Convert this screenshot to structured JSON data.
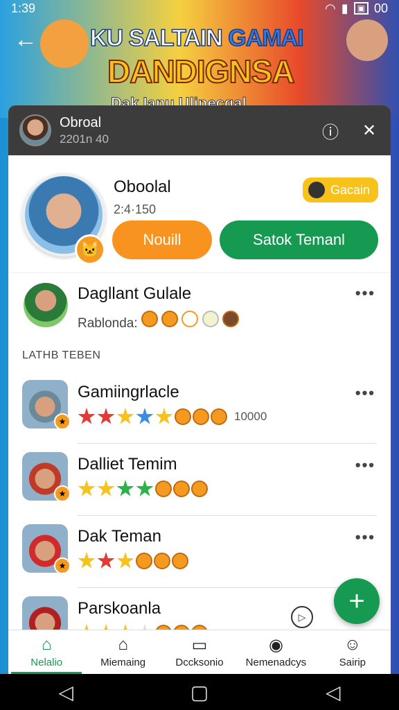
{
  "status": {
    "time": "1:39",
    "battery": "00"
  },
  "banner": {
    "title_a": "KU SALTAIN ",
    "title_b": "GAMAI",
    "title_line2": "DANDIGNSA",
    "subtitle": "Dak Ianu Ulinecgal"
  },
  "header": {
    "name": "Obroal",
    "meta": "2201n  40"
  },
  "profile": {
    "name": "Oboolal",
    "stats": "2:4·150",
    "badge_label": "Gacain",
    "btn_left": "Nouill",
    "btn_right": "Satok Temanl"
  },
  "featured_friend": {
    "name": "Dagllant Gulale",
    "subtitle": "Rablonda:"
  },
  "section_label": "LATHB TEBEN",
  "friends": [
    {
      "name": "Gamiingrlacle",
      "count": "10000",
      "stars": [
        "#e53935",
        "#e53935",
        "#f7c21a",
        "#3a8ee0",
        "#f7c21a"
      ]
    },
    {
      "name": "Dalliet Temim",
      "count": "",
      "stars": [
        "#f7c21a",
        "#f7c21a",
        "#2bb34a",
        "#2bb34a"
      ]
    },
    {
      "name": "Dak Teman",
      "count": "",
      "stars": [
        "#f7c21a",
        "#e53935",
        "#f7c21a"
      ]
    },
    {
      "name": "Parskoanla",
      "count": "",
      "stars": [
        "#f7c21a",
        "#f7c21a",
        "#f7c21a",
        "#ddd"
      ]
    }
  ],
  "nav": [
    {
      "label": "Nelalio",
      "icon": "home-icon"
    },
    {
      "label": "Miemaing",
      "icon": "house-icon"
    },
    {
      "label": "Dccksonio",
      "icon": "board-icon"
    },
    {
      "label": "Nemenadcys",
      "icon": "pin-icon"
    },
    {
      "label": "Sairip",
      "icon": "person-icon"
    }
  ],
  "colors": {
    "accent_green": "#169a52",
    "accent_orange": "#f7931e",
    "gold": "#f7c21a"
  }
}
